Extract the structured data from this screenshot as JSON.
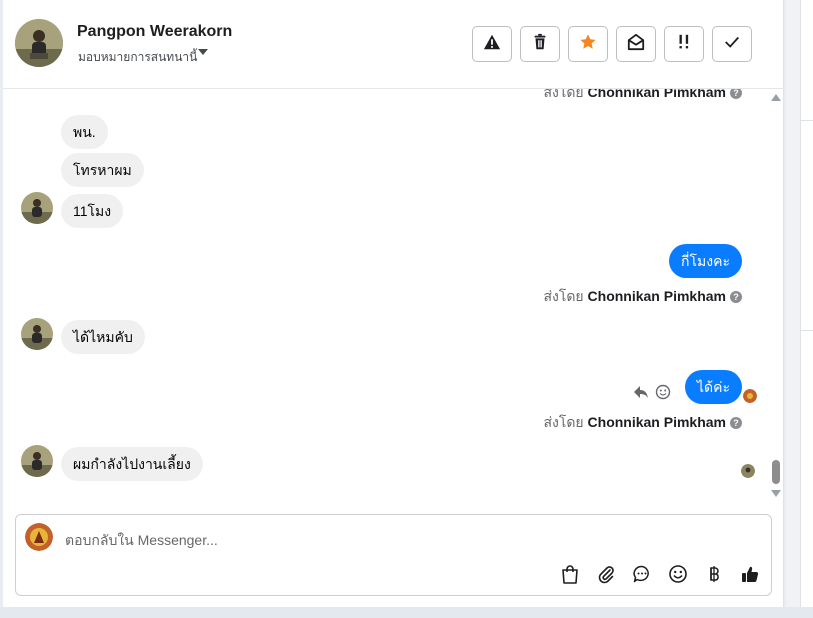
{
  "header": {
    "contact_name": "Pangpon Weerakorn",
    "assign_label": "มอบหมายการสนทนานี้"
  },
  "toolbar": {
    "icons": [
      "warning-icon",
      "trash-icon",
      "star-icon",
      "envelope-open-icon",
      "follow-up-icon",
      "check-icon"
    ],
    "star_color": "#f5851f"
  },
  "messages": {
    "top_sender_prefix": "ส่งโดย",
    "top_sender_name": "Chonnikan Pimkham",
    "in_1": "พน.",
    "in_2": "โทรหาผม",
    "in_3": "11โมง",
    "out_1": "กี่โมงคะ",
    "out_1_sender_prefix": "ส่งโดย",
    "out_1_sender_name": "Chonnikan Pimkham",
    "in_4": "ได้ไหมคับ",
    "out_2": "ได้ค่ะ",
    "out_2_sender_prefix": "ส่งโดย",
    "out_2_sender_name": "Chonnikan Pimkham",
    "in_5": "ผมกำลังไปงานเลี้ยง",
    "outgoing_color": "#0a7cff"
  },
  "composer": {
    "placeholder": "ตอบกลับใน Messenger...",
    "icons": [
      "shopping-bag-icon",
      "paperclip-icon",
      "chat-bubble-icon",
      "emoji-icon",
      "baht-icon",
      "thumbs-up-icon"
    ]
  }
}
